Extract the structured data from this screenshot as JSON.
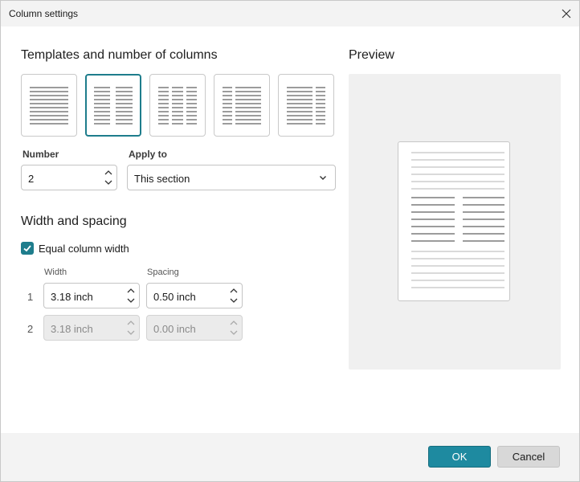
{
  "window": {
    "title": "Column settings"
  },
  "templates_section": {
    "title": "Templates and number of columns",
    "templates": [
      {
        "name": "one-column",
        "selected": false
      },
      {
        "name": "two-columns",
        "selected": true
      },
      {
        "name": "three-columns",
        "selected": false
      },
      {
        "name": "left-narrow",
        "selected": false
      },
      {
        "name": "right-narrow",
        "selected": false
      }
    ]
  },
  "number": {
    "label": "Number",
    "value": "2"
  },
  "apply_to": {
    "label": "Apply to",
    "value": "This section"
  },
  "width_spacing": {
    "title": "Width and spacing",
    "equal_width_label": "Equal column width",
    "equal_width_checked": true,
    "width_header": "Width",
    "spacing_header": "Spacing",
    "rows": [
      {
        "index": "1",
        "width": "3.18 inch",
        "spacing": "0.50 inch",
        "enabled": true
      },
      {
        "index": "2",
        "width": "3.18 inch",
        "spacing": "0.00 inch",
        "enabled": false
      }
    ]
  },
  "preview": {
    "title": "Preview"
  },
  "footer": {
    "ok_label": "OK",
    "cancel_label": "Cancel"
  },
  "colors": {
    "accent": "#1e8aa0",
    "selected_border": "#1e7d8c"
  }
}
